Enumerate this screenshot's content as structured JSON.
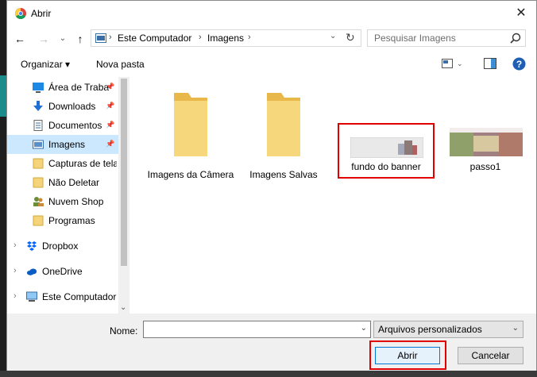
{
  "window": {
    "title": "Abrir",
    "close_glyph": "✕"
  },
  "nav": {
    "back_glyph": "←",
    "forward_glyph": "→",
    "recent_glyph": "⌄",
    "up_glyph": "↑",
    "breadcrumbs": [
      "Este Computador",
      "Imagens"
    ],
    "separator": "›",
    "refresh_glyph": "↻"
  },
  "search": {
    "placeholder": "Pesquisar Imagens"
  },
  "toolbar": {
    "organize": "Organizar ▾",
    "new_folder": "Nova pasta",
    "help": "?"
  },
  "sidebar": {
    "pinned": [
      {
        "label": "Área de Traba",
        "icon": "desktop-icon",
        "pinned": true
      },
      {
        "label": "Downloads",
        "icon": "download-icon",
        "pinned": true
      },
      {
        "label": "Documentos",
        "icon": "documents-icon",
        "pinned": true
      },
      {
        "label": "Imagens",
        "icon": "pictures-icon",
        "pinned": true,
        "selected": true
      },
      {
        "label": "Capturas de tela",
        "icon": "folder-icon"
      },
      {
        "label": "Não Deletar",
        "icon": "folder-icon"
      },
      {
        "label": "Nuvem Shop",
        "icon": "users-icon"
      },
      {
        "label": "Programas",
        "icon": "folder-icon"
      }
    ],
    "groups": [
      {
        "label": "Dropbox",
        "icon": "dropbox-icon"
      },
      {
        "label": "OneDrive",
        "icon": "onedrive-icon"
      },
      {
        "label": "Este Computador",
        "icon": "computer-icon"
      }
    ],
    "pin_glyph": "📌",
    "chev_glyph": "›",
    "scroll_down": "⌄"
  },
  "items": [
    {
      "label": "Imagens da Câmera",
      "type": "folder"
    },
    {
      "label": "Imagens Salvas",
      "type": "folder"
    },
    {
      "label": "fundo do banner",
      "type": "image",
      "highlighted": true
    },
    {
      "label": "passo1",
      "type": "image"
    }
  ],
  "footer": {
    "name_label": "Nome:",
    "name_value": "",
    "filetype": "Arquivos personalizados",
    "open": "Abrir",
    "cancel": "Cancelar",
    "dd_glyph": "⌄"
  },
  "colors": {
    "highlight": "#e00000",
    "selection": "#cce8ff",
    "folder": "#f5d37a"
  }
}
